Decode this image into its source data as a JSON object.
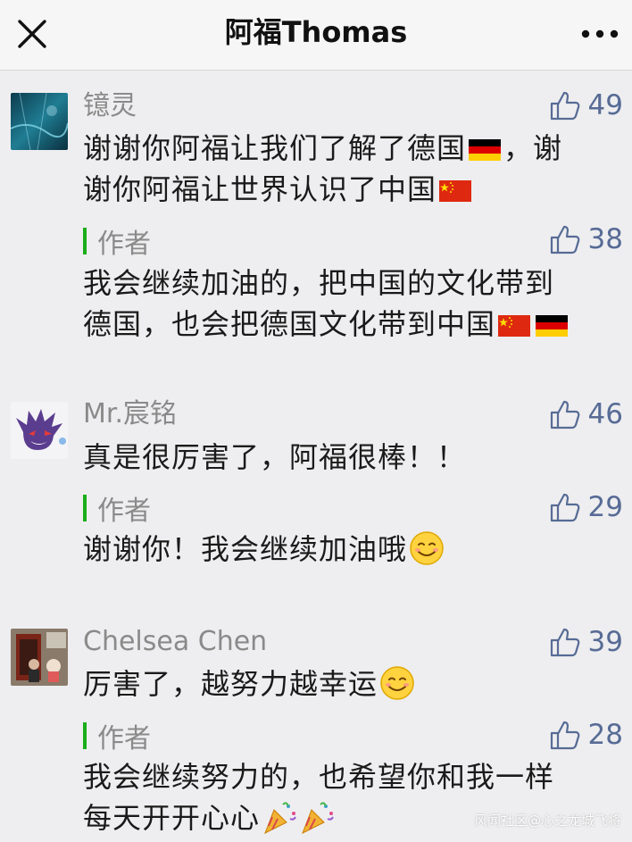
{
  "header": {
    "title": "阿福Thomas",
    "close_icon": "close-icon",
    "more_icon": "more-dots-icon"
  },
  "comments": [
    {
      "nickname": "镱灵",
      "likes": "49",
      "text_line1": "谢谢你阿福让我们了解了德国",
      "text_line1_end": "，谢",
      "text_line2": "谢你阿福让世界认识了中国",
      "reply": {
        "author_label": "作者",
        "likes": "38",
        "text_line1": "我会继续加油的，把中国的文化带到",
        "text_line2": "德国，也会把德国文化带到中国"
      }
    },
    {
      "nickname": "Mr.宸铭",
      "likes": "46",
      "text_line1": "真是很厉害了，阿福很棒！！",
      "reply": {
        "author_label": "作者",
        "likes": "29",
        "text_line1": "谢谢你！我会继续加油哦"
      }
    },
    {
      "nickname": "Chelsea Chen",
      "likes": "39",
      "text_line1": "厉害了，越努力越幸运",
      "reply": {
        "author_label": "作者",
        "likes": "28",
        "text_line1": "我会继续努力的，也希望你和我一样",
        "text_line2": "每天开开心心"
      }
    }
  ],
  "watermark": "风闻社区@心之龙城飞将",
  "colors": {
    "like_blue": "#576b95",
    "author_green": "#1aad19",
    "nickname_gray": "#8a8a8a"
  }
}
